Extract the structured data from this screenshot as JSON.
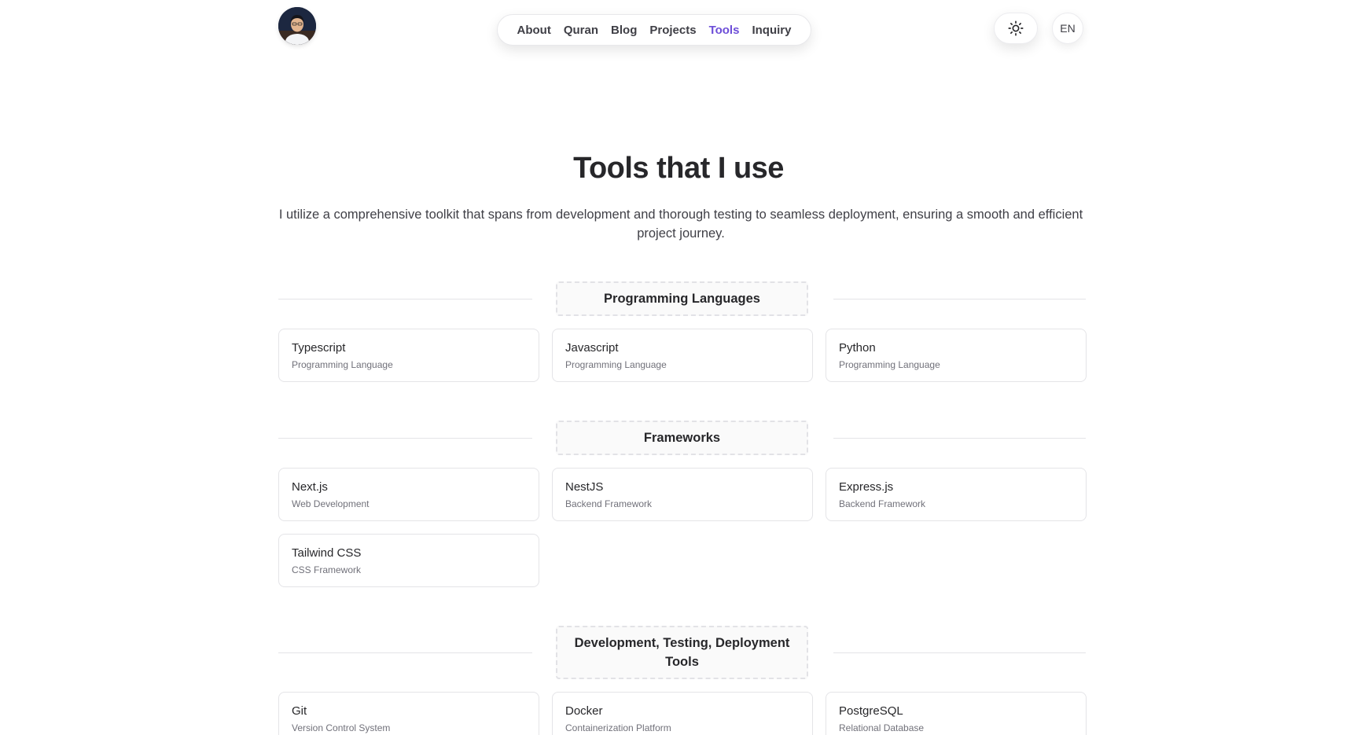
{
  "header": {
    "nav": [
      {
        "label": "About"
      },
      {
        "label": "Quran"
      },
      {
        "label": "Blog"
      },
      {
        "label": "Projects"
      },
      {
        "label": "Tools",
        "active": true
      },
      {
        "label": "Inquiry"
      }
    ],
    "theme_icon": "sun-icon",
    "lang_label": "EN",
    "accent_color": "#6d4ed8"
  },
  "hero": {
    "title": "Tools that I use",
    "subtitle": "I utilize a comprehensive toolkit that spans from development and thorough testing to seamless deployment, ensuring a smooth and efficient project journey."
  },
  "sections": [
    {
      "title": "Programming Languages",
      "items": [
        {
          "name": "Typescript",
          "kind": "Programming Language"
        },
        {
          "name": "Javascript",
          "kind": "Programming Language"
        },
        {
          "name": "Python",
          "kind": "Programming Language"
        }
      ]
    },
    {
      "title": "Frameworks",
      "items": [
        {
          "name": "Next.js",
          "kind": "Web Development"
        },
        {
          "name": "NestJS",
          "kind": "Backend Framework"
        },
        {
          "name": "Express.js",
          "kind": "Backend Framework"
        },
        {
          "name": "Tailwind CSS",
          "kind": "CSS Framework"
        }
      ]
    },
    {
      "title": "Development, Testing, Deployment Tools",
      "items": [
        {
          "name": "Git",
          "kind": "Version Control System"
        },
        {
          "name": "Docker",
          "kind": "Containerization Platform"
        },
        {
          "name": "PostgreSQL",
          "kind": "Relational Database"
        }
      ]
    }
  ]
}
